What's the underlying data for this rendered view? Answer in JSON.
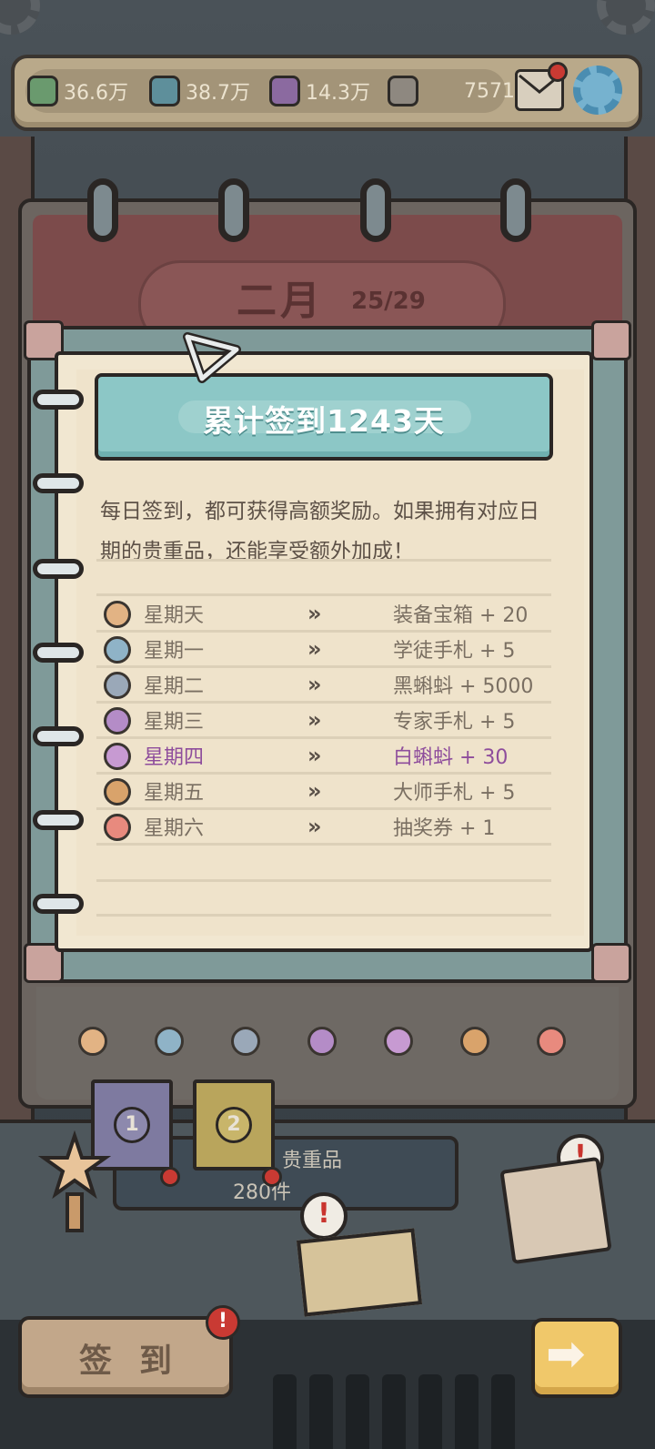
{
  "resources": [
    {
      "value": "36.6万",
      "icon": "green-box-icon",
      "color": "#6a9a6e"
    },
    {
      "value": "38.7万",
      "icon": "teal-box-icon",
      "color": "#5e8f9b"
    },
    {
      "value": "14.3万",
      "icon": "purple-box-icon",
      "color": "#8b6aa0"
    },
    {
      "value": "7571",
      "icon": "grey-box-icon",
      "color": "#8e8880"
    }
  ],
  "calendar": {
    "month": "二月",
    "progress": "25/29"
  },
  "signin": {
    "banner": "累计签到1243天",
    "description": "每日签到，都可获得高额奖励。如果拥有对应日期的贵重品，还能享受额外加成！",
    "arrow_glyph": "»",
    "rows": [
      {
        "day": "星期天",
        "reward": "装备宝箱 + 20",
        "icon": "chest-icon",
        "color": "#e2b384",
        "highlight": false
      },
      {
        "day": "星期一",
        "reward": "学徒手札 + 5",
        "icon": "apprentice-note-icon",
        "color": "#8fb3c7",
        "highlight": false
      },
      {
        "day": "星期二",
        "reward": "黑蝌蚪 + 5000",
        "icon": "black-tadpole-icon",
        "color": "#9aa8b8",
        "highlight": false
      },
      {
        "day": "星期三",
        "reward": "专家手札 + 5",
        "icon": "expert-note-icon",
        "color": "#b48cc7",
        "highlight": false
      },
      {
        "day": "星期四",
        "reward": "白蝌蚪 + 30",
        "icon": "white-tadpole-icon",
        "color": "#c79ad2",
        "highlight": true
      },
      {
        "day": "星期五",
        "reward": "大师手札 + 5",
        "icon": "master-note-icon",
        "color": "#d9a36b",
        "highlight": false
      },
      {
        "day": "星期六",
        "reward": "抽奖券 + 1",
        "icon": "lottery-ticket-icon",
        "color": "#e88a7e",
        "highlight": false
      }
    ]
  },
  "tabs": [
    {
      "number": "1",
      "color": "#7e7aa0"
    },
    {
      "number": "2",
      "color": "#b9a55c"
    }
  ],
  "treasure": {
    "label": "贵重品",
    "count": "280件"
  },
  "buttons": {
    "checkin": "签到",
    "next_glyph": "➡"
  },
  "alert_glyph": "!"
}
